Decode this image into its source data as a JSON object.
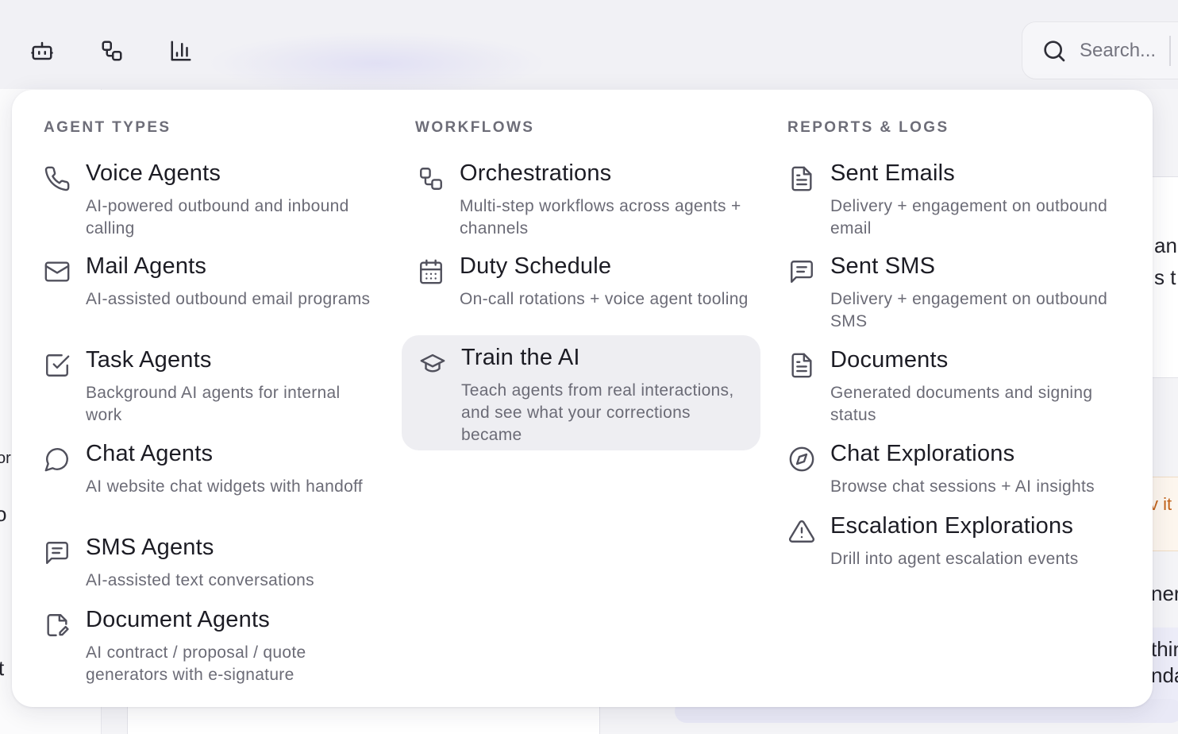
{
  "topbar": {
    "icons": [
      "robot-icon",
      "workflow-icon",
      "bar-chart-icon"
    ],
    "search": {
      "placeholder": "Search...",
      "value": ""
    }
  },
  "background_fragments": {
    "right_top_1": "anc",
    "right_top_2": "s t",
    "right_orange": "v it",
    "right_mid": "nere",
    "right_bottom_1": "thin",
    "right_bottom_2": "nda",
    "left_1": "or",
    "left_2": "o",
    "left_3": "t"
  },
  "menu": {
    "columns": [
      {
        "heading": "AGENT TYPES",
        "items": [
          {
            "icon": "phone-icon",
            "title": "Voice Agents",
            "desc": "AI-powered outbound and inbound calling"
          },
          {
            "icon": "mail-icon",
            "title": "Mail Agents",
            "desc": "AI-assisted outbound email programs"
          },
          {
            "icon": "checkbox-icon",
            "title": "Task Agents",
            "desc": "Background AI agents for internal work"
          },
          {
            "icon": "chat-bubble-icon",
            "title": "Chat Agents",
            "desc": "AI website chat widgets with handoff"
          },
          {
            "icon": "message-lines-icon",
            "title": "SMS Agents",
            "desc": "AI-assisted text conversations"
          },
          {
            "icon": "file-signature-icon",
            "title": "Document Agents",
            "desc": "AI contract / proposal / quote generators with e-signature"
          }
        ]
      },
      {
        "heading": "WORKFLOWS",
        "items": [
          {
            "icon": "workflow-icon",
            "title": "Orchestrations",
            "desc": "Multi-step workflows across agents + channels"
          },
          {
            "icon": "calendar-icon",
            "title": "Duty Schedule",
            "desc": "On-call rotations + voice agent tooling"
          },
          {
            "icon": "graduation-cap-icon",
            "title": "Train the AI",
            "desc": "Teach agents from real interactions, and see what your corrections became",
            "active": true
          }
        ]
      },
      {
        "heading": "REPORTS & LOGS",
        "items": [
          {
            "icon": "document-icon",
            "title": "Sent Emails",
            "desc": "Delivery + engagement on outbound email"
          },
          {
            "icon": "message-lines-icon",
            "title": "Sent SMS",
            "desc": "Delivery + engagement on outbound SMS"
          },
          {
            "icon": "document-icon",
            "title": "Documents",
            "desc": "Generated documents and signing status"
          },
          {
            "icon": "compass-icon",
            "title": "Chat Explorations",
            "desc": "Browse chat sessions + AI insights"
          },
          {
            "icon": "warning-triangle-icon",
            "title": "Escalation Explorations",
            "desc": "Drill into agent escalation events"
          }
        ]
      }
    ]
  }
}
